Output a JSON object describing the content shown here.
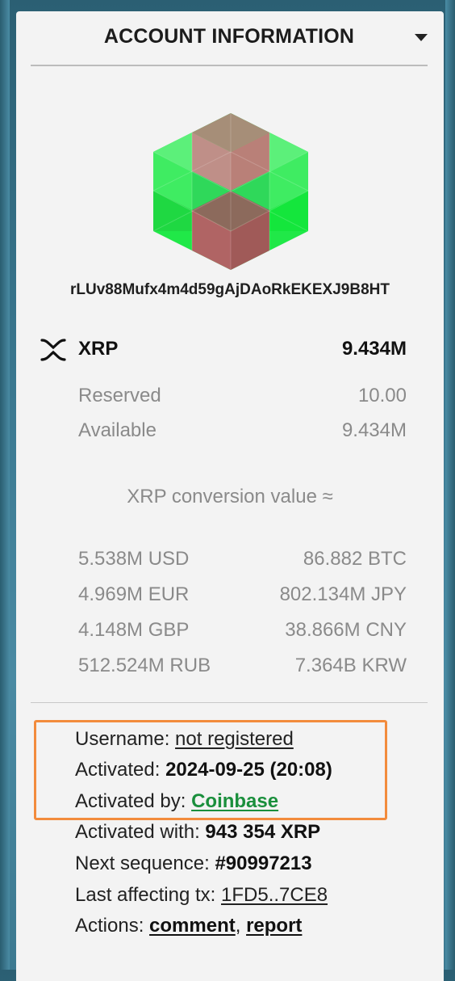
{
  "header": {
    "title": "ACCOUNT INFORMATION"
  },
  "account": {
    "address": "rLUv88Mufx4m4d59gAjDAoRkEKEXJ9B8HT"
  },
  "balance": {
    "currency": "XRP",
    "amount": "9.434M",
    "reserved_label": "Reserved",
    "reserved_value": "10.00",
    "available_label": "Available",
    "available_value": "9.434M"
  },
  "conversion": {
    "title": "XRP conversion value ≈",
    "rows": [
      {
        "left": "5.538M USD",
        "right": "86.882 BTC"
      },
      {
        "left": "4.969M EUR",
        "right": "802.134M JPY"
      },
      {
        "left": "4.148M GBP",
        "right": "38.866M CNY"
      },
      {
        "left": "512.524M RUB",
        "right": "7.364B KRW"
      }
    ]
  },
  "details": {
    "username_label": "Username:",
    "username_value": "not registered",
    "activated_label": "Activated:",
    "activated_value": "2024-09-25 (20:08)",
    "activated_by_label": "Activated by:",
    "activated_by_value": "Coinbase",
    "activated_with_label": "Activated with:",
    "activated_with_value": "943 354 XRP",
    "next_sequence_label": "Next sequence:",
    "next_sequence_value": "#90997213",
    "last_tx_label": "Last affecting tx:",
    "last_tx_value": "1FD5..7CE8",
    "actions_label": "Actions:",
    "action_comment": "comment",
    "action_separator": ",",
    "action_report": "report"
  },
  "colors": {
    "highlight_border": "#f28b3c",
    "link_green": "#1a8f3c",
    "avatar_green": "#22e84a",
    "avatar_brown": "#a5605a"
  },
  "icons": {
    "avatar": "hex-cube-identicon",
    "currency": "xrp-logo-icon",
    "menu": "chevron-down-icon"
  }
}
